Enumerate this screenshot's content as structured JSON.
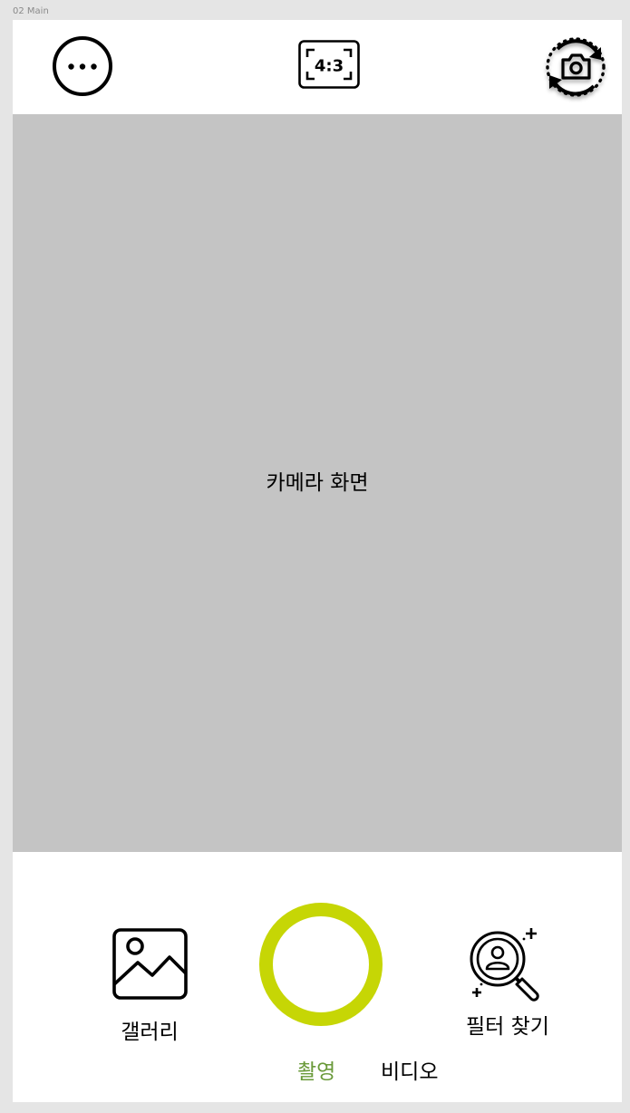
{
  "frame": {
    "label": "02 Main"
  },
  "top_bar": {
    "ratio_icon_text": "4:3"
  },
  "viewfinder": {
    "text": "카메라 화면"
  },
  "bottom": {
    "gallery_label": "갤러리",
    "filter_label": "필터 찾기",
    "modes": {
      "photo": "촬영",
      "video": "비디오"
    }
  },
  "colors": {
    "shutter_ring": "#c6d605",
    "active_mode": "#6a9a3a",
    "viewfinder_bg": "#c4c4c4"
  },
  "icons": [
    "more-icon",
    "aspect-ratio-icon",
    "camera-flip-icon",
    "gallery-icon",
    "filter-search-icon"
  ]
}
